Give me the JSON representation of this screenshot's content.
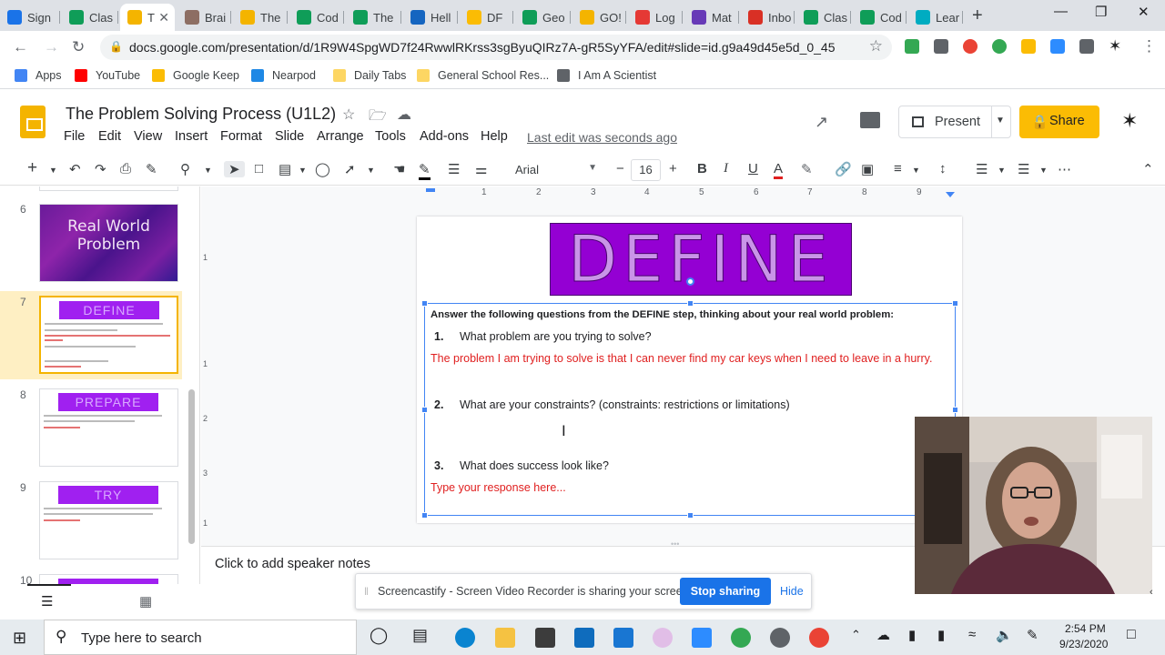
{
  "browser": {
    "tabs": [
      {
        "label": "Sign",
        "color": "#1a73e8"
      },
      {
        "label": "Clas",
        "color": "#0f9d58"
      },
      {
        "label": "T",
        "color": "#f4b400"
      },
      {
        "label": "Brai",
        "color": "#8d6e63"
      },
      {
        "label": "The",
        "color": "#f4b400"
      },
      {
        "label": "Cod",
        "color": "#0f9d58"
      },
      {
        "label": "The",
        "color": "#0f9d58"
      },
      {
        "label": "Hell",
        "color": "#1565c0"
      },
      {
        "label": "DF",
        "color": "#fbbc04"
      },
      {
        "label": "Geo",
        "color": "#0f9d58"
      },
      {
        "label": "GO!",
        "color": "#f4b400"
      },
      {
        "label": "Log",
        "color": "#e53935"
      },
      {
        "label": "Mat",
        "color": "#673ab7"
      },
      {
        "label": "Inbo",
        "color": "#d93025"
      },
      {
        "label": "Clas",
        "color": "#0f9d58"
      },
      {
        "label": "Cod",
        "color": "#0f9d58"
      },
      {
        "label": "Lear",
        "color": "#00acc1"
      }
    ],
    "new_tab": "+",
    "url": "docs.google.com/presentation/d/1R9W4SpgWD7f24RwwlRKrss3sgByuQIRz7A-gR5SyYFA/edit#slide=id.g9a49d45e5d_0_45",
    "bookmarks": [
      {
        "label": "Apps",
        "color": "#4285f4"
      },
      {
        "label": "YouTube",
        "color": "#ff0000"
      },
      {
        "label": "Google Keep",
        "color": "#fbbc04"
      },
      {
        "label": "Nearpod",
        "color": "#1e88e5"
      },
      {
        "label": "Daily Tabs",
        "color": "#fdd663"
      },
      {
        "label": "General School Res...",
        "color": "#fdd663"
      },
      {
        "label": "I Am A Scientist",
        "color": "#5f6368"
      }
    ]
  },
  "slides": {
    "doc_title": "The Problem Solving Process (U1L2)",
    "menu": [
      "File",
      "Edit",
      "View",
      "Insert",
      "Format",
      "Slide",
      "Arrange",
      "Tools",
      "Add-ons",
      "Help"
    ],
    "last_edit": "Last edit was seconds ago",
    "present_label": "Present",
    "share_label": "Share",
    "font_family": "Arial",
    "font_size": "16",
    "speaker_notes": "Click to add speaker notes",
    "ruler_numbers": [
      "1",
      "2",
      "3",
      "4",
      "5",
      "6",
      "7",
      "8",
      "9"
    ],
    "ruler_v_numbers": [
      "1",
      "1",
      "2",
      "3",
      "1"
    ]
  },
  "filmstrip": [
    {
      "num": "6",
      "title": "Real World Problem"
    },
    {
      "num": "7",
      "title": "DEFINE"
    },
    {
      "num": "8",
      "title": "PREPARE"
    },
    {
      "num": "9",
      "title": "TRY"
    },
    {
      "num": "10",
      "title": ""
    }
  ],
  "slide": {
    "banner": "DEFINE",
    "instruction": "Answer the following questions from the DEFINE step, thinking about your real world problem:",
    "questions": [
      {
        "num": "1.",
        "text": "What problem are you trying to solve?"
      },
      {
        "num": "2.",
        "text": "What are your constraints? (constraints: restrictions or limitations)"
      },
      {
        "num": "3.",
        "text": "What does success look like?"
      }
    ],
    "answer_1": "The problem I am trying to solve is that I can never find my car keys when I need to leave in a hurry.",
    "answer_3": "Type your response here..."
  },
  "screencastify": {
    "message": "Screencastify - Screen Video Recorder is sharing your screen.",
    "stop_label": "Stop sharing",
    "hide_label": "Hide"
  },
  "taskbar": {
    "search_placeholder": "Type here to search",
    "time": "2:54 PM",
    "date": "9/23/2020"
  }
}
